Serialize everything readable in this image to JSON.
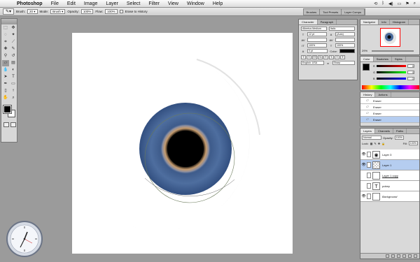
{
  "menubar": {
    "app_name": "Photoshop",
    "items": [
      "File",
      "Edit",
      "Image",
      "Layer",
      "Select",
      "Filter",
      "View",
      "Window",
      "Help"
    ]
  },
  "options": {
    "brush_label": "Brush:",
    "brush_size": "20",
    "mode_label": "Mode:",
    "mode_value": "Brush",
    "opacity_label": "Opacity:",
    "opacity_value": "100%",
    "flow_label": "Flow:",
    "flow_value": "100%",
    "erase_history_label": "Erase to History",
    "palette_tabs": [
      "Brushes",
      "Tool Presets",
      "Layer Comps"
    ]
  },
  "character": {
    "tabs": [
      "Character",
      "Paragraph"
    ],
    "font_family": "Albertus Medium",
    "font_style": "Italic",
    "font_size": "12 pt",
    "leading": "(Auto)",
    "tracking": "100%",
    "vertical_scale": "100%",
    "baseline": "0 pt",
    "color_label": "Color:",
    "language": "English: USA",
    "antialias": "Sharp",
    "format_buttons": [
      "T",
      "T",
      "TT",
      "Tr",
      "T'",
      "T,",
      "T",
      "Ŧ"
    ]
  },
  "navigator": {
    "tabs": [
      "Navigator",
      "Info",
      "Histogram"
    ],
    "zoom": "29%"
  },
  "color": {
    "tabs": [
      "Color",
      "Swatches",
      "Styles"
    ],
    "r": "0",
    "g": "0",
    "b": "0"
  },
  "history": {
    "tabs": [
      "History",
      "Actions"
    ],
    "items": [
      "Eraser",
      "Eraser",
      "Eraser",
      "Eraser"
    ]
  },
  "layers": {
    "tabs": [
      "Layers",
      "Channels",
      "Paths"
    ],
    "blend_mode": "Normal",
    "opacity_label": "Opacity:",
    "opacity_value": "100%",
    "lock_label": "Lock:",
    "fill_label": "Fill:",
    "fill_value": "100%",
    "items": [
      {
        "name": "Layer 3",
        "selected": false,
        "icon": "eye-thumb"
      },
      {
        "name": "Layer 1",
        "selected": true,
        "icon": "transparent-thumb"
      },
      {
        "name": "Layer 1 copy",
        "selected": false,
        "icon": "white-thumb"
      },
      {
        "name": "pokep",
        "selected": false,
        "icon": "text-thumb"
      },
      {
        "name": "Background",
        "selected": false,
        "icon": "white-thumb"
      }
    ]
  },
  "colors": {
    "iris": "#4a6a9b",
    "pupil": "#000000",
    "accent_selection": "#b5cdf0"
  }
}
